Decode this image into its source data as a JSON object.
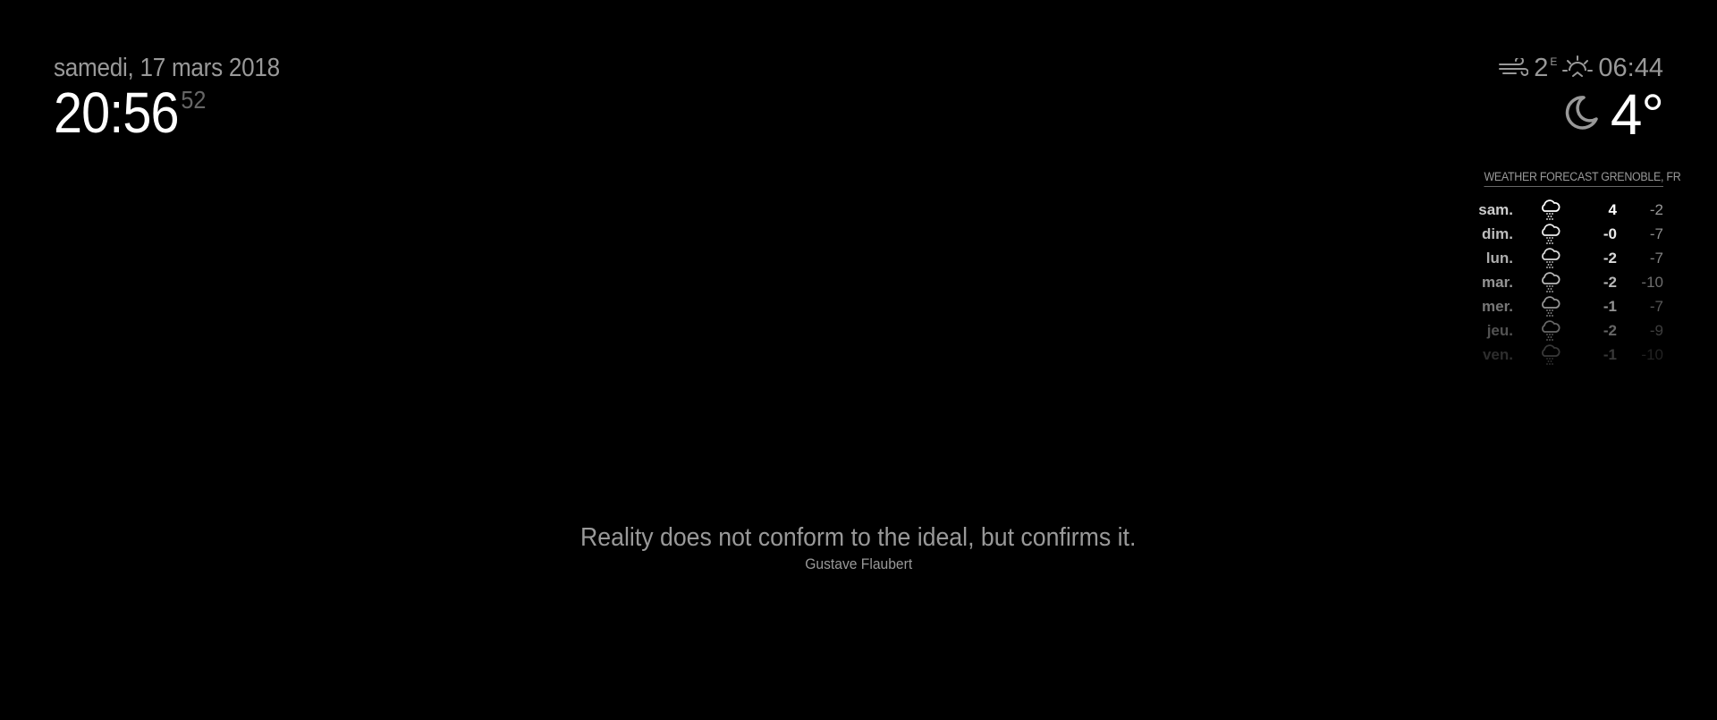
{
  "clock": {
    "date": "samedi, 17 mars 2018",
    "time_hm": "20:56",
    "time_seconds": "52"
  },
  "current_weather": {
    "wind_speed": "2",
    "wind_direction": "E",
    "sunrise_time": "06:44",
    "temperature": "4°",
    "icons": {
      "wind": "wind-icon",
      "sunrise": "sunrise-icon",
      "condition": "night-clear-moon-icon"
    }
  },
  "forecast": {
    "header": "WEATHER FORECAST GRENOBLE, FR",
    "rows": [
      {
        "day": "sam.",
        "icon": "snow-icon",
        "max": "4",
        "min": "-2"
      },
      {
        "day": "dim.",
        "icon": "snow-icon",
        "max": "-0",
        "min": "-7"
      },
      {
        "day": "lun.",
        "icon": "snow-icon",
        "max": "-2",
        "min": "-7"
      },
      {
        "day": "mar.",
        "icon": "snow-icon",
        "max": "-2",
        "min": "-10"
      },
      {
        "day": "mer.",
        "icon": "snow-icon",
        "max": "-1",
        "min": "-7"
      },
      {
        "day": "jeu.",
        "icon": "snow-icon",
        "max": "-2",
        "min": "-9"
      },
      {
        "day": "ven.",
        "icon": "snow-icon",
        "max": "-1",
        "min": "-10"
      }
    ]
  },
  "quote": {
    "text": "Reality does not conform to the ideal, but confirms it.",
    "author": "Gustave Flaubert"
  },
  "colors": {
    "background": "#000000",
    "bright": "#ffffff",
    "normal": "#999999",
    "dimmed": "#666666"
  }
}
